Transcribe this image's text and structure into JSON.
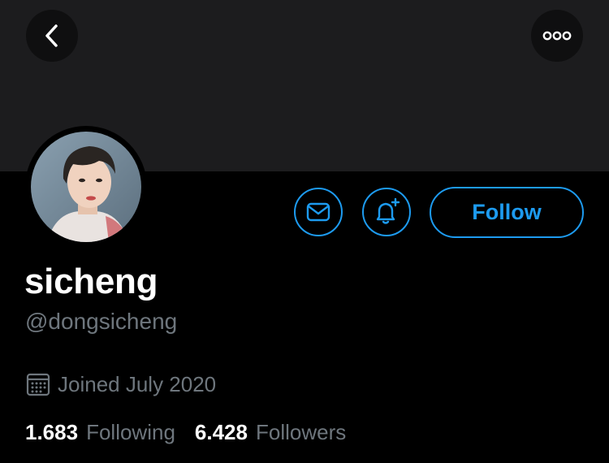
{
  "profile": {
    "display_name": "sicheng",
    "handle": "@dongsicheng",
    "joined": "Joined July 2020",
    "avatar_icon": "user-avatar-photo"
  },
  "stats": {
    "following_count": "1.683",
    "following_label": "Following",
    "followers_count": "6.428",
    "followers_label": "Followers"
  },
  "actions": {
    "follow_label": "Follow",
    "message_icon": "envelope-icon",
    "notify_icon": "bell-plus-icon",
    "back_icon": "chevron-left-icon",
    "more_icon": "more-dots-icon"
  },
  "colors": {
    "accent": "#1d9bf0",
    "background": "#000000",
    "banner": "#1c1c1e",
    "muted_text": "#6e767d"
  }
}
